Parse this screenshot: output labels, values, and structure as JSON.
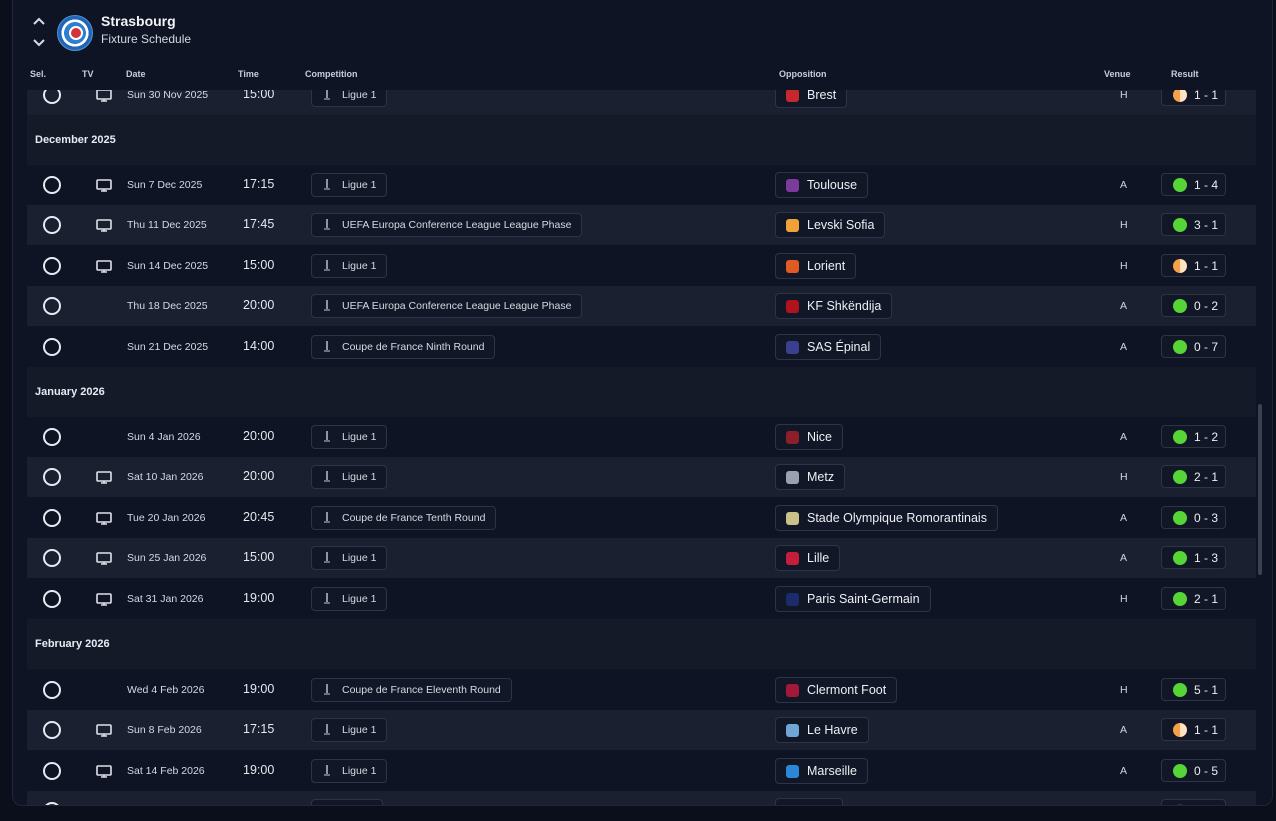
{
  "header": {
    "club_name": "Strasbourg",
    "page_title": "Fixture Schedule"
  },
  "columns": {
    "sel": "Sel.",
    "tv": "TV",
    "date": "Date",
    "time": "Time",
    "competition": "Competition",
    "opposition": "Opposition",
    "venue": "Venue",
    "result": "Result"
  },
  "months": [
    "December 2025",
    "January 2026",
    "February 2026"
  ],
  "fixtures": [
    {
      "date": "Sun 30 Nov 2025",
      "time": "15:00",
      "competition": "Ligue 1",
      "opposition": "Brest",
      "venue": "H",
      "result": "1 - 1",
      "outcome": "draw",
      "tv": true
    },
    {
      "date": "Sun 7 Dec 2025",
      "time": "17:15",
      "competition": "Ligue 1",
      "opposition": "Toulouse",
      "venue": "A",
      "result": "1 - 4",
      "outcome": "win",
      "tv": true
    },
    {
      "date": "Thu 11 Dec 2025",
      "time": "17:45",
      "competition": "UEFA Europa Conference League League Phase",
      "opposition": "Levski Sofia",
      "venue": "H",
      "result": "3 - 1",
      "outcome": "win",
      "tv": true
    },
    {
      "date": "Sun 14 Dec 2025",
      "time": "15:00",
      "competition": "Ligue 1",
      "opposition": "Lorient",
      "venue": "H",
      "result": "1 - 1",
      "outcome": "draw",
      "tv": true
    },
    {
      "date": "Thu 18 Dec 2025",
      "time": "20:00",
      "competition": "UEFA Europa Conference League League Phase",
      "opposition": "KF Shkëndija",
      "venue": "A",
      "result": "0 - 2",
      "outcome": "win",
      "tv": false
    },
    {
      "date": "Sun 21 Dec 2025",
      "time": "14:00",
      "competition": "Coupe de France Ninth Round",
      "opposition": "SAS Épinal",
      "venue": "A",
      "result": "0 - 7",
      "outcome": "win",
      "tv": false
    },
    {
      "date": "Sun 4 Jan 2026",
      "time": "20:00",
      "competition": "Ligue 1",
      "opposition": "Nice",
      "venue": "A",
      "result": "1 - 2",
      "outcome": "win",
      "tv": false
    },
    {
      "date": "Sat 10 Jan 2026",
      "time": "20:00",
      "competition": "Ligue 1",
      "opposition": "Metz",
      "venue": "H",
      "result": "2 - 1",
      "outcome": "win",
      "tv": true
    },
    {
      "date": "Tue 20 Jan 2026",
      "time": "20:45",
      "competition": "Coupe de France Tenth Round",
      "opposition": "Stade Olympique Romorantinais",
      "venue": "A",
      "result": "0 - 3",
      "outcome": "win",
      "tv": true
    },
    {
      "date": "Sun 25 Jan 2026",
      "time": "15:00",
      "competition": "Ligue 1",
      "opposition": "Lille",
      "venue": "A",
      "result": "1 - 3",
      "outcome": "win",
      "tv": true
    },
    {
      "date": "Sat 31 Jan 2026",
      "time": "19:00",
      "competition": "Ligue 1",
      "opposition": "Paris Saint-Germain",
      "venue": "H",
      "result": "2 - 1",
      "outcome": "win",
      "tv": true
    },
    {
      "date": "Wed 4 Feb 2026",
      "time": "19:00",
      "competition": "Coupe de France Eleventh Round",
      "opposition": "Clermont Foot",
      "venue": "H",
      "result": "5 - 1",
      "outcome": "win",
      "tv": false
    },
    {
      "date": "Sun 8 Feb 2026",
      "time": "17:15",
      "competition": "Ligue 1",
      "opposition": "Le Havre",
      "venue": "A",
      "result": "1 - 1",
      "outcome": "draw",
      "tv": true
    },
    {
      "date": "Sat 14 Feb 2026",
      "time": "19:00",
      "competition": "Ligue 1",
      "opposition": "Marseille",
      "venue": "A",
      "result": "0 - 5",
      "outcome": "win",
      "tv": true
    },
    {
      "date": "",
      "time": "",
      "competition": "",
      "opposition": "",
      "venue": "",
      "result": "",
      "outcome": "none",
      "tv": false
    }
  ],
  "colors": {
    "win": "#56d636",
    "draw": "#f6a04a",
    "background": "#0f1424",
    "row_alt": "#1a2030"
  },
  "icons": {
    "tv": "tv-monitor-icon",
    "select": "radio-circle-icon",
    "expand_up": "chevron-up-icon",
    "expand_down": "chevron-down-icon"
  }
}
